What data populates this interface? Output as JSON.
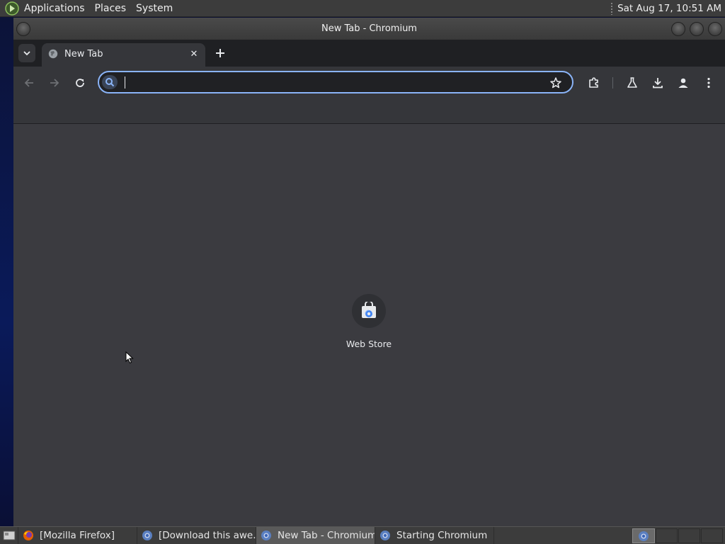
{
  "top_panel": {
    "menus": [
      "Applications",
      "Places",
      "System"
    ],
    "clock": "Sat Aug 17, 10:51 AM",
    "logo_icon": "distro-logo-icon"
  },
  "window": {
    "title": "New Tab - Chromium",
    "controls": [
      "minimize-icon",
      "maximize-icon",
      "close-icon"
    ]
  },
  "tabs": [
    {
      "label": "New Tab",
      "active": true,
      "icon": "globe-icon"
    }
  ],
  "toolbar": {
    "omnibox_value": "",
    "buttons": [
      "back-icon",
      "forward-icon",
      "reload-icon",
      "bookmark-star-icon",
      "extensions-icon",
      "labs-flask-icon",
      "download-icon",
      "profile-icon",
      "menu-dots-icon"
    ]
  },
  "new_tab_page": {
    "shortcuts": [
      {
        "label": "Web Store",
        "icon": "web-store-icon"
      }
    ]
  },
  "taskbar": {
    "items": [
      {
        "label": "[Mozilla Firefox]",
        "icon": "firefox-icon",
        "active": false
      },
      {
        "label": "[Download this awe...",
        "icon": "chromium-icon",
        "active": false
      },
      {
        "label": "New Tab - Chromium",
        "icon": "chromium-icon",
        "active": true
      },
      {
        "label": "Starting Chromium",
        "icon": "chromium-icon",
        "active": false
      }
    ]
  },
  "colors": {
    "accent": "#8ab4f8",
    "panel": "#3c3c3c",
    "toolbar": "#35363a",
    "content": "#3b3b40"
  }
}
